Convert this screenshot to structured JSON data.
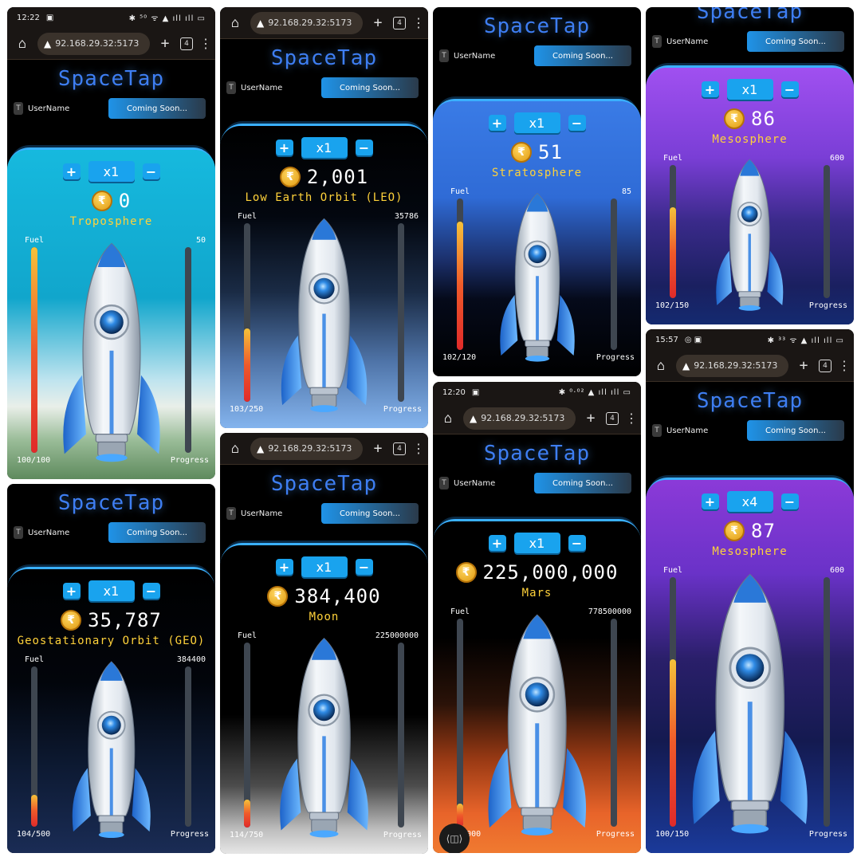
{
  "app": {
    "title": "SpaceTap",
    "user": "UserName",
    "coming_soon": "Coming Soon...",
    "user_initial": "T",
    "url": "92.168.29.32:5173",
    "tab_count": "4",
    "coin_symbol": "₹",
    "plus": "+",
    "minus": "−",
    "fuel_label": "Fuel",
    "progress_label": "Progress"
  },
  "panels": [
    {
      "id": "p1",
      "status_time": "12:22",
      "status_icons": "▣",
      "status_right": "✱ ⁵⁰ ᯤ ▲ ıll ıll ▭",
      "multiplier": "x1",
      "coins": "0",
      "location": "Troposphere",
      "fuel_text": "100/100",
      "fuel_level": 1.0,
      "progress_max": "50",
      "bg": "linear-gradient(180deg,#16b9de 0%,#11a6cc 45%,#bfe4ef 70%,#e9efe9 78%,#9bbd99 88%,#5e8a5d 100%)"
    },
    {
      "id": "p2",
      "multiplier": "x1",
      "coins": "2,001",
      "location": "Low Earth Orbit (LEO)",
      "fuel_text": "103/250",
      "fuel_level": 0.41,
      "progress_max": "35786",
      "bg": "linear-gradient(180deg,#000 0%,#03070f 30%,#1a2b45 55%,#4f74a8 78%,#84b4ee 100%)"
    },
    {
      "id": "p3",
      "multiplier": "x1",
      "coins": "51",
      "location": "Stratosphere",
      "fuel_text": "102/120",
      "fuel_level": 0.85,
      "progress_max": "85",
      "bg": "linear-gradient(180deg,#3a7be6 0%,#2f6bd6 35%,#1b2f6a 58%,#050a1a 72%,#000 100%)"
    },
    {
      "id": "p4",
      "multiplier": "x1",
      "coins": "86",
      "location": "Mesosphere",
      "fuel_text": "102/150",
      "fuel_level": 0.68,
      "progress_max": "600",
      "bg": "linear-gradient(180deg,#a050f0 0%,#7a3ed6 35%,#3a2a8a 60%,#1a2060 85%,#142a70 100%)"
    },
    {
      "id": "p5",
      "multiplier": "x1",
      "coins": "35,787",
      "location": "Geostationary Orbit (GEO)",
      "fuel_text": "104/500",
      "fuel_level": 0.2,
      "progress_max": "384400",
      "bg": "linear-gradient(180deg,#000 0%,#02050b 40%,#0d1a33 70%,#1a2c55 100%)"
    },
    {
      "id": "p6",
      "multiplier": "x1",
      "coins": "384,400",
      "location": "Moon",
      "fuel_text": "114/750",
      "fuel_level": 0.15,
      "progress_max": "225000000",
      "bg": "linear-gradient(180deg,#000 0%,#000 55%,#4c4c4c 78%,#bdbdbd 92%,#e6e6e6 100%)"
    },
    {
      "id": "p7",
      "status_time": "12:20",
      "status_icons": "▣",
      "status_right": "✱ ⁰·⁰² ▲ ıll ıll ▭",
      "multiplier": "x1",
      "coins": "225,000,000",
      "location": "Mars",
      "fuel_text": "106/1000",
      "fuel_level": 0.11,
      "progress_max": "778500000",
      "bg": "linear-gradient(180deg,#000 0%,#000 35%,#2a1208 55%,#9a3a14 72%,#e8642a 88%,#f07a30 100%)",
      "float_icon": "⟨◫⟩"
    },
    {
      "id": "p8",
      "status_time": "15:57",
      "status_icons": "◎ ▣",
      "status_right": "✱ ³³ ᯤ ▲ ıll ıll ▭",
      "multiplier": "x4",
      "coins": "87",
      "location": "Mesosphere",
      "fuel_text": "100/150",
      "fuel_level": 0.67,
      "progress_max": "600",
      "bg": "linear-gradient(180deg,#8b3ad8 0%,#6a32c8 25%,#2a1f6a 48%,#141a50 70%,#1a3a9a 100%)"
    }
  ]
}
